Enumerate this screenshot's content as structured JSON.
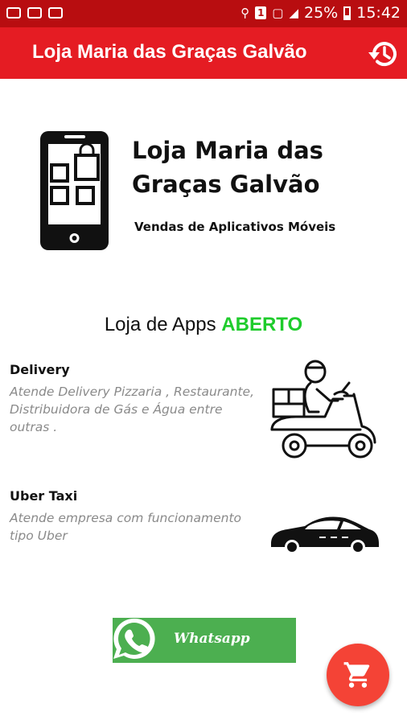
{
  "status_bar": {
    "battery": "25%",
    "time": "15:42",
    "sim_label": "1"
  },
  "app_bar": {
    "title": "Loja Maria das Graças Galvão",
    "history_icon": "history-icon"
  },
  "brand": {
    "name": "Loja Maria das Graças Galvão",
    "subtitle": "Vendas de Aplicativos Móveis"
  },
  "store_status": {
    "label": "Loja de Apps",
    "state": "ABERTO",
    "state_color": "#1fcc2c"
  },
  "services": [
    {
      "title": "Delivery",
      "description": "Atende Delivery Pizzaria , Restaurante, Distribuidora de Gás e Água entre outras ."
    },
    {
      "title": "Uber Taxi",
      "description": "Atende empresa com funcionamento tipo Uber"
    }
  ],
  "whatsapp": {
    "label": "Whatsapp",
    "color": "#4caf50"
  },
  "colors": {
    "status_bar": "#b80d10",
    "app_bar": "#e51c23",
    "fab": "#f44336"
  }
}
